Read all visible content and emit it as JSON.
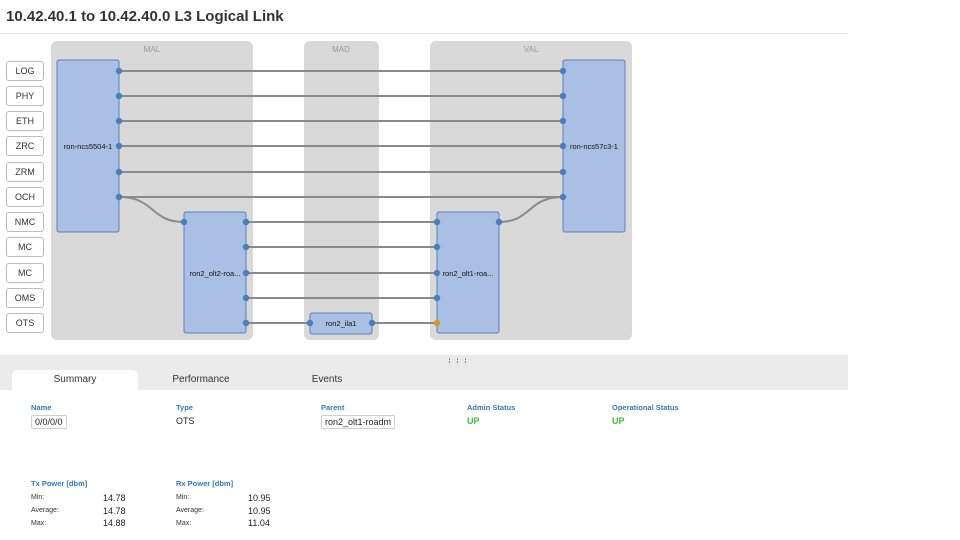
{
  "page_title": "10.42.40.1 to 10.42.40.0 L3 Logical Link",
  "row_labels": [
    "LOG",
    "PHY",
    "ETH",
    "ZRC",
    "ZRM",
    "OCH",
    "NMC",
    "MC",
    "MC",
    "OMS",
    "OTS"
  ],
  "sites": {
    "mal": "MAL",
    "mad": "MAD",
    "val": "VAL"
  },
  "nodes": {
    "router_a": "ron-ncs5504-1",
    "router_b": "ron-ncs57c3-1",
    "roadm_a": "ron2_olt2-roa...",
    "roadm_b": "ron2_olt1-roa...",
    "ila": "ron2_ila1"
  },
  "tabs": [
    "Summary",
    "Performance",
    "Events"
  ],
  "summary": {
    "name_label": "Name",
    "name_value": "0/0/0/0",
    "type_label": "Type",
    "type_value": "OTS",
    "parent_label": "Parent",
    "parent_value": "ron2_olt1-roadm",
    "admin_label": "Admin Status",
    "admin_value": "UP",
    "oper_label": "Operational Status",
    "oper_value": "UP"
  },
  "tx_power": {
    "label": "Tx Power [dbm]",
    "min_label": "Min:",
    "min": "14.78",
    "avg_label": "Average:",
    "avg": "14.78",
    "max_label": "Max:",
    "max": "14.88"
  },
  "rx_power": {
    "label": "Rx Power [dbm]",
    "min_label": "Min:",
    "min": "10.95",
    "avg_label": "Average:",
    "avg": "10.95",
    "max_label": "Max:",
    "max": "11.04"
  },
  "colors": {
    "node_fill": "#a9c0e4",
    "node_stroke": "#5b80b8",
    "port": "#4a7fbd",
    "port_selected": "#e0922c",
    "link": "#8a8a8a",
    "site_bg": "#d9d9d9",
    "accent": "#2f7bbd",
    "status_up": "#3bbf3b"
  }
}
